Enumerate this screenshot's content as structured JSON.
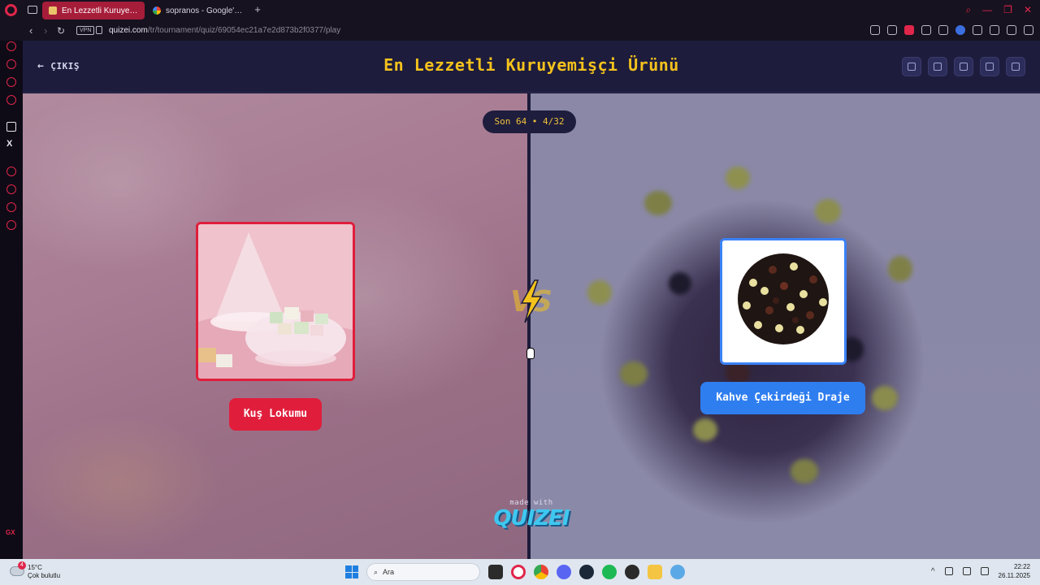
{
  "browser": {
    "tabs": [
      {
        "label": "En Lezzetli Kuruyemişçi Ü",
        "active": true
      },
      {
        "label": "sopranos - Google'da Ara",
        "active": false
      }
    ],
    "new_tab": "+",
    "vpn_label": "VPN",
    "url_host": "quizei.com",
    "url_path": "/tr/tournament/quiz/69054ec21a7e2d873b2f0377/play",
    "window_controls": [
      "⌕",
      "—",
      "❐",
      "✕"
    ]
  },
  "quiz": {
    "exit_label": "ÇIKIŞ",
    "title": "En Lezzetli Kuruyemişçi Ürünü",
    "header_buttons": [
      "undo-icon",
      "share-icon",
      "send-icon",
      "flag-icon",
      "fullscreen-icon"
    ],
    "round": "Son 64 • 4/32",
    "vs_label": "VS",
    "left_choice": "Kuş Lokumu",
    "right_choice": "Kahve Çekirdeği Draje",
    "made_with": "made with",
    "brand": "QUIZEI",
    "collapse_icon": "chevron-up-icon"
  },
  "taskbar": {
    "weather_badge": "4",
    "temperature": "15°C",
    "weather_desc": "Çok bulutlu",
    "search_placeholder": "Ara",
    "time": "22:22",
    "date": "26.11.2025"
  },
  "colors": {
    "accent_yellow": "#f4c21c",
    "left_red": "#e01e3c",
    "right_blue": "#2f7ef0",
    "page_bg": "#1c1b3a",
    "opera_red": "#e0264a"
  }
}
